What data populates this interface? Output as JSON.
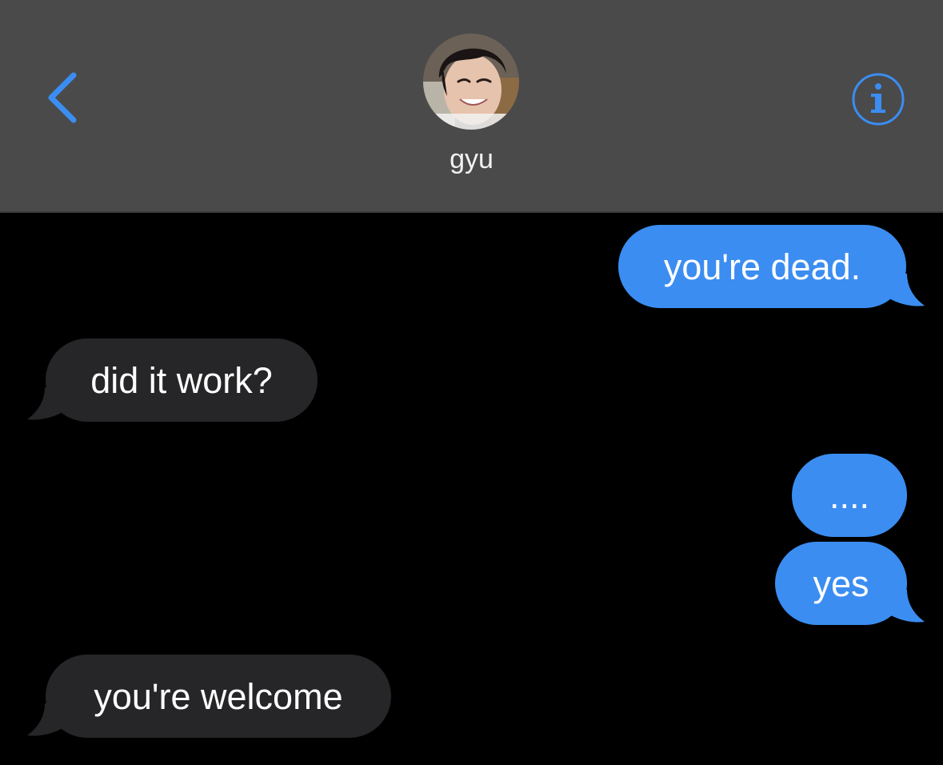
{
  "header": {
    "back_icon": "chevron-left-icon",
    "contact_name": "gyu",
    "info_icon": "info-circle-icon",
    "accent_color": "#3b8df1",
    "header_bg": "#4a4a4a"
  },
  "messages": [
    {
      "direction": "outgoing",
      "text": "you're dead."
    },
    {
      "direction": "incoming",
      "text": "did it work?"
    },
    {
      "direction": "outgoing",
      "text": "...."
    },
    {
      "direction": "outgoing",
      "text": "yes"
    },
    {
      "direction": "incoming",
      "text": "you're welcome"
    }
  ],
  "colors": {
    "outgoing_bubble": "#3b8df1",
    "incoming_bubble": "#262628",
    "background": "#000000"
  }
}
